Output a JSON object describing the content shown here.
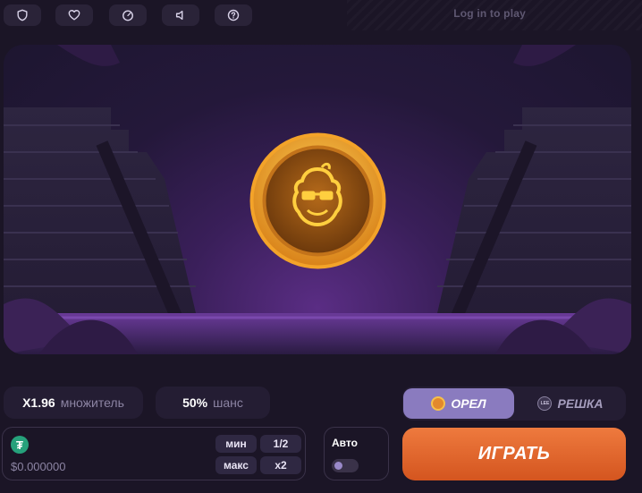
{
  "topbar": {
    "icons": [
      "shield-icon",
      "heart-icon",
      "speedometer-icon",
      "volume-icon",
      "help-icon"
    ],
    "login_text": "Log in to play"
  },
  "stats": {
    "multiplier_value": "X1.96",
    "multiplier_label": "множитель",
    "chance_value": "50%",
    "chance_label": "шанс"
  },
  "bet": {
    "currency_icon": "tether-icon",
    "currency_symbol": "₮",
    "amount": "$0.000000",
    "min_label": "мин",
    "half_label": "1/2",
    "max_label": "макс",
    "double_label": "x2"
  },
  "auto": {
    "label": "Авто",
    "enabled": false
  },
  "side": {
    "heads_label": "ОРЕЛ",
    "tails_label": "РЕШКА",
    "tails_icon_text": "LEE",
    "selected": "heads"
  },
  "play_label": "ИГРАТЬ",
  "colors": {
    "background": "#1b1526",
    "accent_orange": "#e56b30",
    "active_side": "#8a7bbf",
    "coin_gold": "#f0b23a"
  }
}
